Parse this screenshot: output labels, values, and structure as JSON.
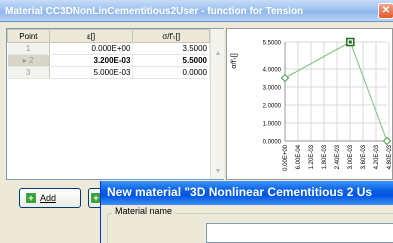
{
  "window": {
    "title": "Material CC3DNonLinCementitious2User - function for Tension",
    "close_glyph": "✕"
  },
  "table": {
    "headers": [
      "Point",
      "ε[]",
      "σ/f'ₜ[]"
    ],
    "rows": [
      {
        "point": "1",
        "eps": "0.000E+00",
        "sig": "3.5000",
        "marker": ""
      },
      {
        "point": "2",
        "eps": "3.200E-03",
        "sig": "5.5000",
        "marker": "▸"
      },
      {
        "point": "3",
        "eps": "5.000E-03",
        "sig": "0.0000",
        "marker": ""
      }
    ]
  },
  "chart_data": {
    "type": "line",
    "ylabel": "σ/f'ₜ[]",
    "y_ticks": [
      "5.5000",
      "4.0000",
      "3.0000",
      "2.0000",
      "1.0000",
      "0.0000"
    ],
    "x_tick_labels": [
      "0.00E+00",
      "6.00E-04",
      "1.20E-03",
      "1.80E-03",
      "2.40E-03",
      "3.00E-03",
      "3.60E-03",
      "4.20E-03",
      "4.80E-03"
    ],
    "x": [
      0.0,
      0.0032,
      0.005
    ],
    "y": [
      3.5,
      5.5,
      0.0
    ],
    "ylim": [
      0,
      5.5
    ],
    "xlim": [
      0,
      0.005
    ],
    "selected_point": 1,
    "grid": true,
    "colors": {
      "line": "#7fbf7f",
      "marker": "#4c9a4c",
      "selected": "#1e6e1e"
    }
  },
  "buttons": {
    "add_label": "Add",
    "add_icon": "plus-icon"
  },
  "dialog": {
    "title": "New material \"3D Nonlinear Cementitious 2 Us",
    "group_label": "Material name",
    "name_value": ""
  },
  "colors": {
    "titlebar_active": "#0054e3",
    "titlebar_inactive": "#9ec1ef"
  }
}
